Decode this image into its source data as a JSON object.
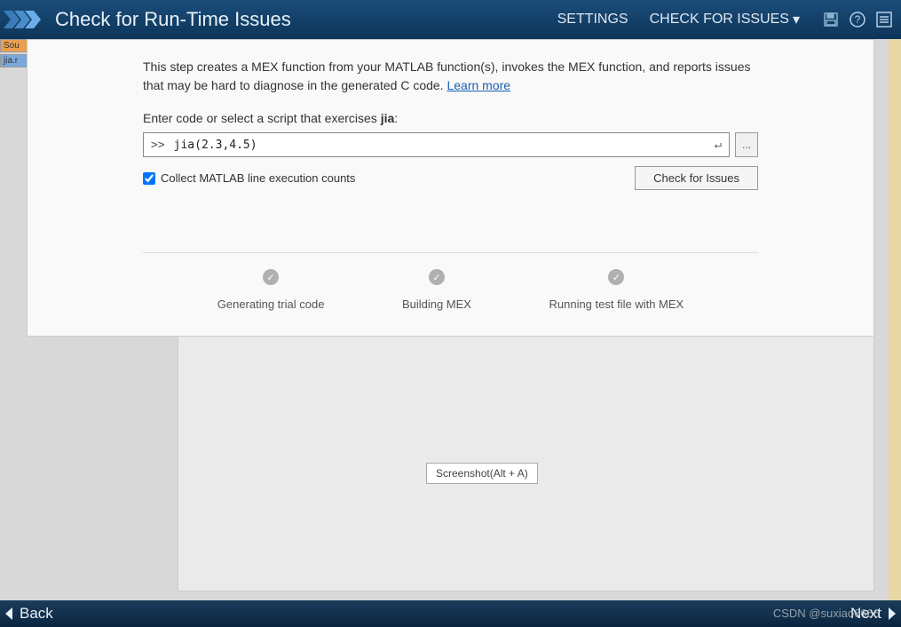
{
  "header": {
    "title": "Check for Run-Time Issues",
    "settings_label": "SETTINGS",
    "check_dropdown_label": "CHECK FOR ISSUES"
  },
  "left_tabs": {
    "tab1": "Sou",
    "tab2": "jia.r"
  },
  "content": {
    "description": "This step creates a MEX function from your MATLAB function(s), invokes the MEX function, and reports issues that may be hard to diagnose in the generated C code.",
    "learn_more": "Learn more",
    "prompt_prefix": "Enter code or select a script that exercises ",
    "prompt_target": "jia",
    "code_prompt": ">>",
    "code_value": "jia(2.3,4.5)",
    "browse_dots": "...",
    "checkbox_label": "Collect MATLAB line execution counts",
    "check_button": "Check for Issues"
  },
  "progress": {
    "steps": [
      {
        "label": "Generating trial code"
      },
      {
        "label": "Building MEX"
      },
      {
        "label": "Running test file with MEX"
      }
    ]
  },
  "tooltip": "Screenshot(Alt + A)",
  "footer": {
    "back": "Back",
    "next": "Next"
  },
  "watermark": "CSDN @suxiao6666"
}
